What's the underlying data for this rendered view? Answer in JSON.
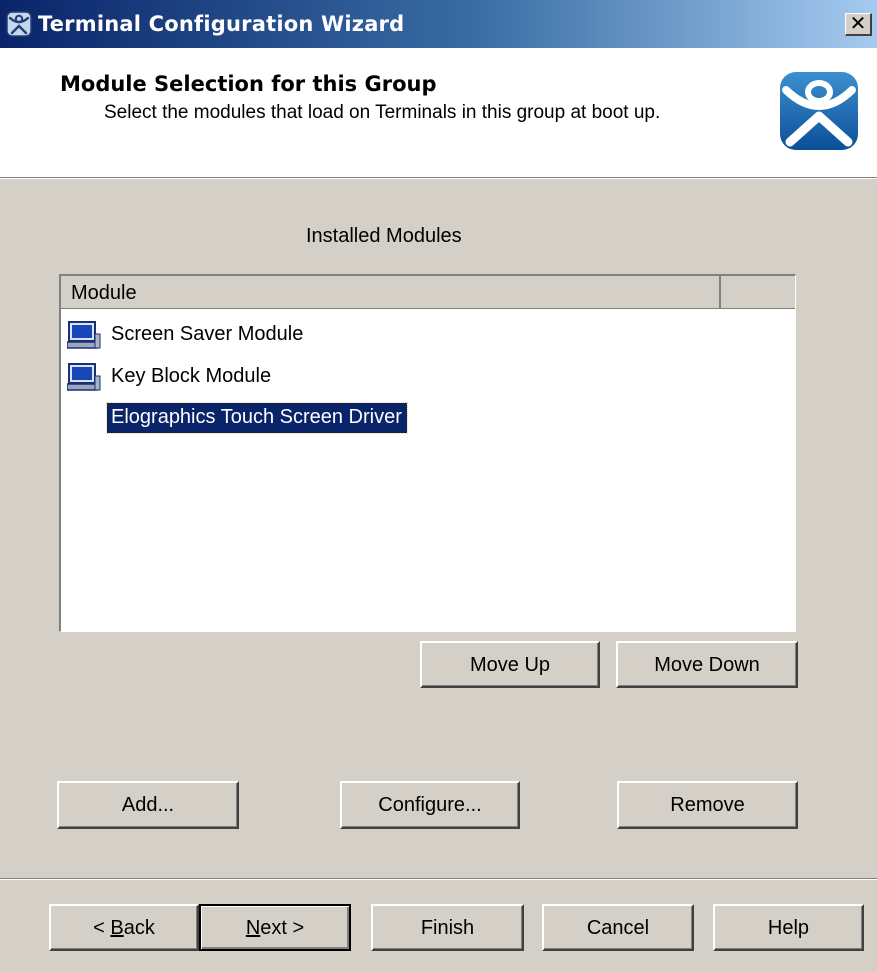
{
  "window": {
    "title": "Terminal Configuration Wizard",
    "close_glyph": "✕"
  },
  "header": {
    "title": "Module Selection for this Group",
    "subtitle": "Select the modules that load on Terminals in this group at boot up."
  },
  "section": {
    "label": "Installed Modules"
  },
  "list": {
    "columns": [
      "Module",
      ""
    ],
    "items": [
      {
        "label": "Screen Saver Module",
        "icon": "terminal-module-icon"
      },
      {
        "label": "Key Block Module",
        "icon": "terminal-module-icon"
      },
      {
        "label": "Elographics Touch Screen Driver",
        "icon": "",
        "selected": true
      }
    ]
  },
  "buttons": {
    "move_up": "Move Up",
    "move_down": "Move Down",
    "add": "Add...",
    "configure": "Configure...",
    "remove": "Remove",
    "back_prefix": "< ",
    "back_key": "B",
    "back_rest": "ack",
    "next_key": "N",
    "next_rest": "ext >",
    "finish": "Finish",
    "cancel": "Cancel",
    "help": "Help"
  },
  "colors": {
    "selection": "#0a246a",
    "dialog": "#d4d0c8",
    "titlebar_start": "#0a246a",
    "titlebar_end": "#a6caf0"
  }
}
